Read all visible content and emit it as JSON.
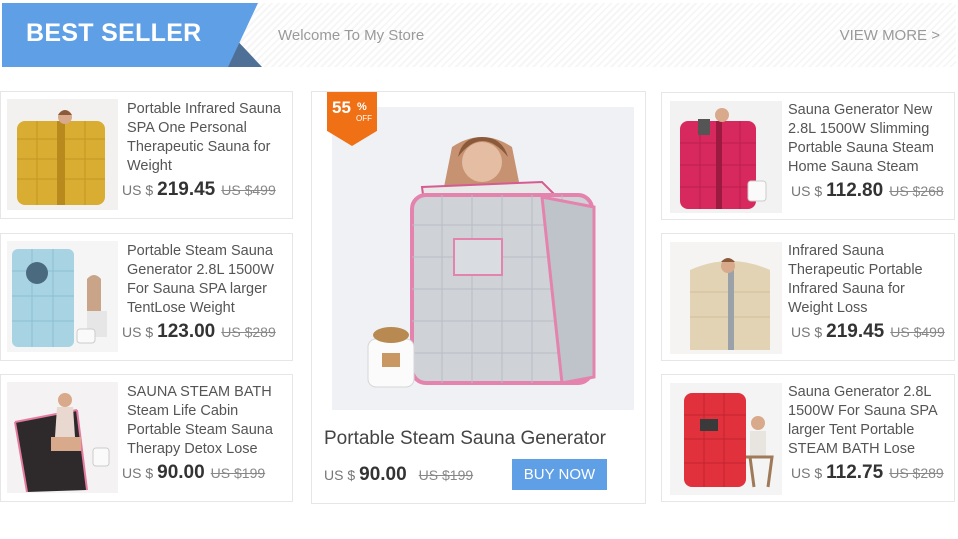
{
  "header": {
    "title": "BEST SELLER",
    "welcome": "Welcome To My Store",
    "view_more": "VIEW MORE >"
  },
  "colors": {
    "banner_blue": "#5f9fe6",
    "banner_dark": "#4e7096",
    "badge_orange": "#f07015",
    "button_blue": "#5f9fe6"
  },
  "left_products": [
    {
      "name": "Portable Infrared Sauna SPA One Personal Therapeutic Sauna for Weight",
      "currency": "US $",
      "price": "219.45",
      "old_price": "US $499",
      "tent_color": "gold"
    },
    {
      "name": "Portable Steam Sauna Generator 2.8L 1500W For Sauna SPA larger TentLose Weight",
      "currency": "US $",
      "price": "123.00",
      "old_price": "US $289",
      "tent_color": "light-blue"
    },
    {
      "name": "SAUNA STEAM BATH Steam Life Cabin Portable Steam Sauna Therapy Detox Lose",
      "currency": "US $",
      "price": "90.00",
      "old_price": "US $199",
      "tent_color": "black-pink"
    }
  ],
  "featured": {
    "badge_number": "55",
    "badge_percent": "%",
    "badge_off": "OFF",
    "title": "Portable Steam Sauna Generator",
    "currency": "US $",
    "price": "90.00",
    "old_price": "US $199",
    "buy_label": "BUY NOW"
  },
  "right_products": [
    {
      "name": "Sauna Generator New 2.8L 1500W Slimming Portable Sauna Steam Home Sauna Steam",
      "currency": "US $",
      "price": "112.80",
      "old_price": "US $268",
      "tent_color": "pink"
    },
    {
      "name": "Infrared Sauna Therapeutic Portable Infrared Sauna for Weight Loss",
      "currency": "US $",
      "price": "219.45",
      "old_price": "US $499",
      "tent_color": "beige"
    },
    {
      "name": "Sauna Generator 2.8L 1500W For Sauna SPA larger Tent Portable STEAM BATH Lose",
      "currency": "US $",
      "price": "112.75",
      "old_price": "US $289",
      "tent_color": "red"
    }
  ]
}
